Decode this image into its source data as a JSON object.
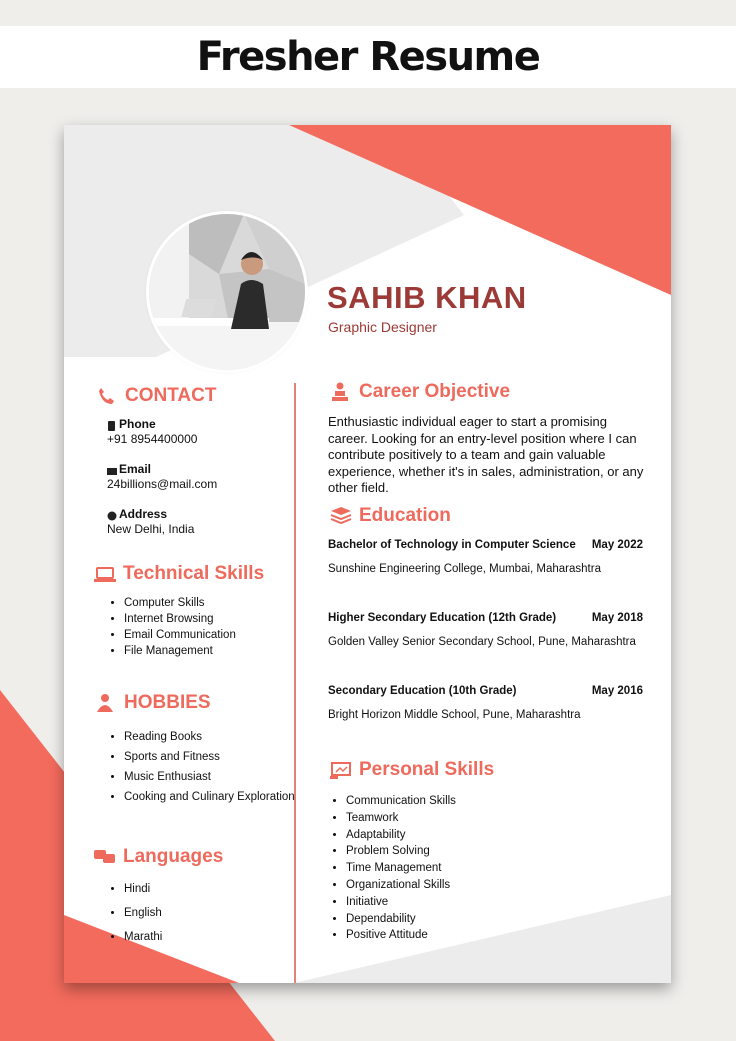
{
  "banner": {
    "title": "Fresher Resume"
  },
  "colors": {
    "accent": "#f36b5d",
    "name": "#9b3a36",
    "heading": "#ee6a5c",
    "light_gray": "#ececec"
  },
  "resume": {
    "name": "SAHIB KHAN",
    "role": "Graphic Designer",
    "contact": {
      "title": "CONTACT",
      "phone_label": "Phone",
      "phone": "+91 8954400000",
      "email_label": "Email",
      "email": "24billions@mail.com",
      "address_label": "Address",
      "address": "New Delhi, India"
    },
    "technical_skills": {
      "title": "Technical Skills",
      "items": [
        "Computer Skills",
        "Internet Browsing",
        "Email Communication",
        "File Management"
      ]
    },
    "hobbies": {
      "title": "HOBBIES",
      "items": [
        "Reading Books",
        "Sports and Fitness",
        "Music Enthusiast",
        "Cooking and Culinary Exploration"
      ]
    },
    "languages": {
      "title": "Languages",
      "items": [
        "Hindi",
        "English",
        "Marathi"
      ]
    },
    "career_objective": {
      "title": "Career Objective",
      "text": "Enthusiastic individual eager to start a promising career. Looking for an entry-level position where I can contribute positively to a team and gain valuable experience, whether it's in sales, administration, or any other field."
    },
    "education": {
      "title": "Education",
      "entries": [
        {
          "degree": "Bachelor of Technology in Computer Science",
          "date": "May 2022",
          "school": "Sunshine Engineering College, Mumbai, Maharashtra"
        },
        {
          "degree": "Higher Secondary Education (12th Grade)",
          "date": "May 2018",
          "school": "Golden Valley Senior Secondary School, Pune, Maharashtra"
        },
        {
          "degree": "Secondary Education (10th Grade)",
          "date": "May 2016",
          "school": "Bright Horizon Middle School, Pune, Maharashtra"
        }
      ]
    },
    "personal_skills": {
      "title": "Personal Skills",
      "items": [
        "Communication Skills",
        "Teamwork",
        "Adaptability",
        "Problem Solving",
        "Time Management",
        "Organizational Skills",
        "Initiative",
        "Dependability",
        "Positive Attitude"
      ]
    }
  }
}
